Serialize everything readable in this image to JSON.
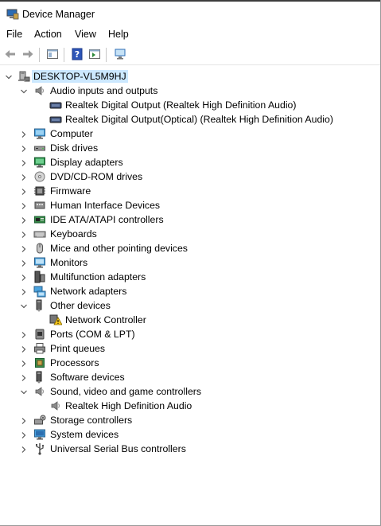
{
  "window": {
    "title": "Device Manager"
  },
  "menu": [
    {
      "name": "menu-file",
      "label": "File"
    },
    {
      "name": "menu-action",
      "label": "Action"
    },
    {
      "name": "menu-view",
      "label": "View"
    },
    {
      "name": "menu-help",
      "label": "Help"
    }
  ],
  "toolbar": [
    {
      "name": "back-button",
      "icon": "back-arrow-icon"
    },
    {
      "name": "forward-button",
      "icon": "forward-arrow-icon"
    },
    {
      "name": "show-hide-console-tree-button",
      "icon": "console-tree-icon"
    },
    {
      "name": "help-button",
      "icon": "help-icon"
    },
    {
      "name": "action-pane-button",
      "icon": "action-pane-icon"
    },
    {
      "name": "scan-hardware-button",
      "icon": "monitor-scan-icon"
    }
  ],
  "tree": {
    "root": {
      "label": "DESKTOP-VL5M9HJ",
      "icon": "computer-tree-icon",
      "expanded": true
    },
    "categories": [
      {
        "label": "Audio inputs and outputs",
        "icon": "speaker-icon",
        "expanded": true,
        "children": [
          {
            "label": "Realtek Digital Output (Realtek High Definition Audio)",
            "icon": "audio-device-icon"
          },
          {
            "label": "Realtek Digital Output(Optical) (Realtek High Definition Audio)",
            "icon": "audio-device-icon"
          }
        ]
      },
      {
        "label": "Computer",
        "icon": "computer-icon",
        "expanded": false
      },
      {
        "label": "Disk drives",
        "icon": "disk-drive-icon",
        "expanded": false
      },
      {
        "label": "Display adapters",
        "icon": "display-adapter-icon",
        "expanded": false
      },
      {
        "label": "DVD/CD-ROM drives",
        "icon": "dvd-drive-icon",
        "expanded": false
      },
      {
        "label": "Firmware",
        "icon": "firmware-icon",
        "expanded": false
      },
      {
        "label": "Human Interface Devices",
        "icon": "hid-icon",
        "expanded": false
      },
      {
        "label": "IDE ATA/ATAPI controllers",
        "icon": "ide-controller-icon",
        "expanded": false
      },
      {
        "label": "Keyboards",
        "icon": "keyboard-icon",
        "expanded": false
      },
      {
        "label": "Mice and other pointing devices",
        "icon": "mouse-icon",
        "expanded": false
      },
      {
        "label": "Monitors",
        "icon": "monitor-icon",
        "expanded": false
      },
      {
        "label": "Multifunction adapters",
        "icon": "multifunction-icon",
        "expanded": false
      },
      {
        "label": "Network adapters",
        "icon": "network-adapter-icon",
        "expanded": false
      },
      {
        "label": "Other devices",
        "icon": "other-devices-icon",
        "expanded": true,
        "children": [
          {
            "label": "Network Controller",
            "icon": "warning-device-icon"
          }
        ]
      },
      {
        "label": "Ports (COM & LPT)",
        "icon": "port-icon",
        "expanded": false
      },
      {
        "label": "Print queues",
        "icon": "printer-icon",
        "expanded": false
      },
      {
        "label": "Processors",
        "icon": "processor-icon",
        "expanded": false
      },
      {
        "label": "Software devices",
        "icon": "software-device-icon",
        "expanded": false
      },
      {
        "label": "Sound, video and game controllers",
        "icon": "speaker-icon",
        "expanded": true,
        "children": [
          {
            "label": "Realtek High Definition Audio",
            "icon": "speaker-icon"
          }
        ]
      },
      {
        "label": "Storage controllers",
        "icon": "storage-controller-icon",
        "expanded": false
      },
      {
        "label": "System devices",
        "icon": "system-devices-icon",
        "expanded": false
      },
      {
        "label": "Universal Serial Bus controllers",
        "icon": "usb-icon",
        "expanded": false
      }
    ]
  }
}
